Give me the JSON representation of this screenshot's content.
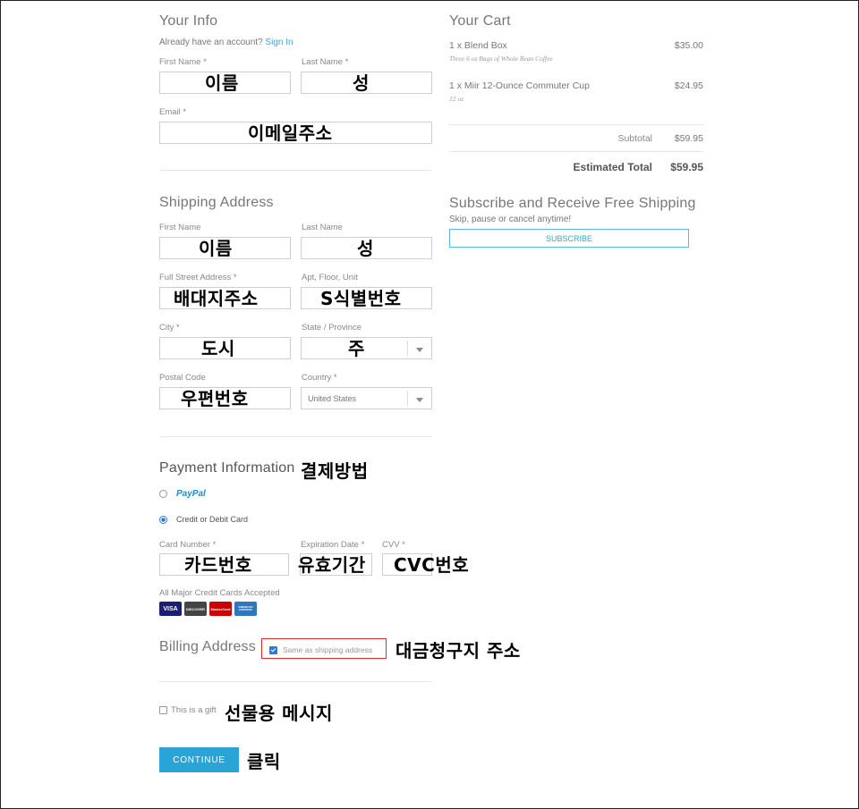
{
  "your_info": {
    "heading": "Your Info",
    "account_prompt": "Already have an account?",
    "sign_in": "Sign In",
    "first_name_label": "First Name",
    "last_name_label": "Last Name",
    "email_label": "Email",
    "required_mark": "*",
    "first_name_value": "이름",
    "last_name_value": "성",
    "email_value": "이메일주소"
  },
  "shipping": {
    "heading": "Shipping Address",
    "first_name_label": "First Name",
    "last_name_label": "Last Name",
    "street_label": "Full Street Address",
    "apt_label": "Apt, Floor, Unit",
    "city_label": "City",
    "state_label": "State / Province",
    "postal_label": "Postal Code",
    "country_label": "Country",
    "first_name_value": "이름",
    "last_name_value": "성",
    "street_value": "배대지주소",
    "apt_value": "S식별번호",
    "city_value": "도시",
    "state_value": "주",
    "postal_value": "우편번호",
    "country_value": "United States"
  },
  "payment": {
    "heading": "Payment Information",
    "annotation": "결제방법",
    "paypal_label": "PayPal",
    "card_option_label": "Credit or Debit Card",
    "card_number_label": "Card Number *",
    "expiration_label": "Expiration Date *",
    "cvv_label": "CVV *",
    "card_number_value": "카드번호",
    "expiration_value": "유효기간",
    "cvv_value": "CVC번호",
    "accepted_cards_label": "All Major Credit Cards Accepted",
    "cards": [
      {
        "name": "VISA",
        "color": "#1a1f71"
      },
      {
        "name": "DISCOVER",
        "color": "#444444"
      },
      {
        "name": "MasterCard",
        "color": "#cc0000"
      },
      {
        "name": "AMERICAN EXPRESS",
        "color": "#2e77bc"
      }
    ]
  },
  "billing": {
    "heading": "Billing Address",
    "same_as_shipping": "Same as shipping address",
    "annotation": "대금청구지 주소",
    "highlight_color": "#d32f2f"
  },
  "gift": {
    "label": "This is a gift",
    "annotation": "선물용 메시지"
  },
  "continue": {
    "label": "CONTINUE",
    "annotation": "클릭"
  },
  "cart": {
    "heading": "Your Cart",
    "items": [
      {
        "title": "1 x Blend Box",
        "subtitle": "Three 6 oz Bags of Whole Bean Coffee",
        "price": "$35.00"
      },
      {
        "title": "1 x Miir 12-Ounce Commuter Cup",
        "subtitle": "12 oz",
        "price": "$24.95"
      }
    ],
    "subtotal_label": "Subtotal",
    "subtotal_value": "$59.95",
    "total_label": "Estimated Total",
    "total_value": "$59.95"
  },
  "subscribe": {
    "heading": "Subscribe and Receive Free Shipping",
    "subtext": "Skip, pause or cancel anytime!",
    "button": "SUBSCRIBE"
  },
  "colors": {
    "accent": "#2aa3d5",
    "link": "#3aa7c9"
  }
}
